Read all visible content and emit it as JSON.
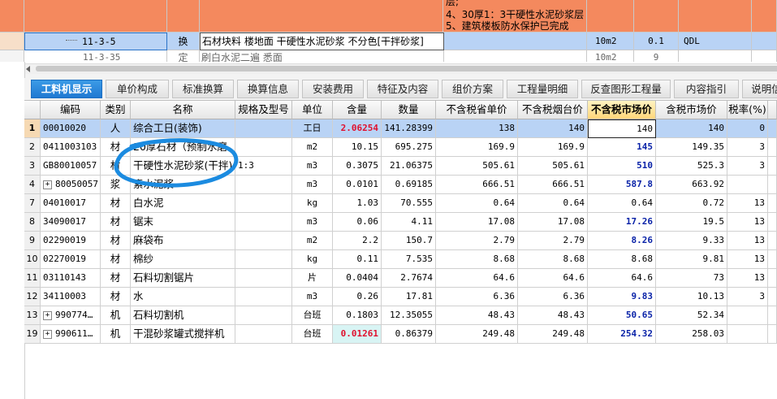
{
  "upper": {
    "top_row_text": [
      "层;",
      "4、30厚1：3干硬性水泥砂浆层",
      "5、建筑楼板防水保护已完成"
    ],
    "selected_row": {
      "code": "11-3-5",
      "type": "换",
      "name": "石材块料 楼地面 干硬性水泥砂浆 不分色[干拌砂浆]",
      "unit": "10m2",
      "qty": "0.1",
      "expr": "QDL"
    },
    "partial_row": {
      "code": "11-3-35",
      "type": "定",
      "name": "刷白水泥二遍 悉面",
      "unit": "10m2",
      "qty": "9"
    }
  },
  "tabs": [
    {
      "label": "工料机显示",
      "active": true
    },
    {
      "label": "单价构成",
      "active": false
    },
    {
      "label": "标准换算",
      "active": false
    },
    {
      "label": "换算信息",
      "active": false
    },
    {
      "label": "安装费用",
      "active": false
    },
    {
      "label": "特征及内容",
      "active": false
    },
    {
      "label": "组价方案",
      "active": false
    },
    {
      "label": "工程量明细",
      "active": false
    },
    {
      "label": "反查图形工程量",
      "active": false
    },
    {
      "label": "内容指引",
      "active": false
    },
    {
      "label": "说明信",
      "active": false
    }
  ],
  "columns": [
    "编码",
    "类别",
    "名称",
    "规格及型号",
    "单位",
    "含量",
    "数量",
    "不含税省单价",
    "不含税烟台价",
    "不含税市场价",
    "含税市场价",
    "税率(%)"
  ],
  "rows": [
    {
      "no": "1",
      "expand": false,
      "code": "00010020",
      "cat": "人",
      "name": "综合工日(装饰)",
      "spec": "",
      "unit": "工日",
      "content": "2.06254",
      "qty": "141.28399",
      "prov": "138",
      "yt": "140",
      "market": "140",
      "tax_market": "140",
      "rate": "0"
    },
    {
      "no": "2",
      "expand": false,
      "code": "0411003103",
      "cat": "材",
      "name": "20厚石材（预制水磨",
      "spec": "",
      "unit": "m2",
      "content": "10.15",
      "qty": "695.275",
      "prov": "169.9",
      "yt": "169.9",
      "market": "145",
      "tax_market": "149.35",
      "rate": "3"
    },
    {
      "no": "3",
      "expand": false,
      "code": "GB80010057",
      "cat": "材",
      "name": "干硬性水泥砂浆(干拌)",
      "spec": "1:3",
      "unit": "m3",
      "content": "0.3075",
      "qty": "21.06375",
      "prov": "505.61",
      "yt": "505.61",
      "market": "510",
      "tax_market": "525.3",
      "rate": "3"
    },
    {
      "no": "4",
      "expand": true,
      "code": "80050057",
      "cat": "浆",
      "name": "素水泥浆",
      "spec": "",
      "unit": "m3",
      "content": "0.0101",
      "qty": "0.69185",
      "prov": "666.51",
      "yt": "666.51",
      "market": "587.8",
      "tax_market": "663.92",
      "rate": ""
    },
    {
      "no": "7",
      "expand": false,
      "code": "04010017",
      "cat": "材",
      "name": "白水泥",
      "spec": "",
      "unit": "kg",
      "content": "1.03",
      "qty": "70.555",
      "prov": "0.64",
      "yt": "0.64",
      "market": "0.64",
      "tax_market": "0.72",
      "rate": "13"
    },
    {
      "no": "8",
      "expand": false,
      "code": "34090017",
      "cat": "材",
      "name": "锯末",
      "spec": "",
      "unit": "m3",
      "content": "0.06",
      "qty": "4.11",
      "prov": "17.08",
      "yt": "17.08",
      "market": "17.26",
      "tax_market": "19.5",
      "rate": "13"
    },
    {
      "no": "9",
      "expand": false,
      "code": "02290019",
      "cat": "材",
      "name": "麻袋布",
      "spec": "",
      "unit": "m2",
      "content": "2.2",
      "qty": "150.7",
      "prov": "2.79",
      "yt": "2.79",
      "market": "8.26",
      "tax_market": "9.33",
      "rate": "13"
    },
    {
      "no": "10",
      "expand": false,
      "code": "02270019",
      "cat": "材",
      "name": "棉纱",
      "spec": "",
      "unit": "kg",
      "content": "0.11",
      "qty": "7.535",
      "prov": "8.68",
      "yt": "8.68",
      "market": "8.68",
      "tax_market": "9.81",
      "rate": "13"
    },
    {
      "no": "11",
      "expand": false,
      "code": "03110143",
      "cat": "材",
      "name": "石料切割锯片",
      "spec": "",
      "unit": "片",
      "content": "0.0404",
      "qty": "2.7674",
      "prov": "64.6",
      "yt": "64.6",
      "market": "64.6",
      "tax_market": "73",
      "rate": "13"
    },
    {
      "no": "12",
      "expand": false,
      "code": "34110003",
      "cat": "材",
      "name": "水",
      "spec": "",
      "unit": "m3",
      "content": "0.26",
      "qty": "17.81",
      "prov": "6.36",
      "yt": "6.36",
      "market": "9.83",
      "tax_market": "10.13",
      "rate": "3"
    },
    {
      "no": "13",
      "expand": true,
      "code": "990774…",
      "cat": "机",
      "name": "石料切割机",
      "spec": "",
      "unit": "台班",
      "content": "0.1803",
      "qty": "12.35055",
      "prov": "48.43",
      "yt": "48.43",
      "market": "50.65",
      "tax_market": "52.34",
      "rate": ""
    },
    {
      "no": "19",
      "expand": true,
      "code": "990611…",
      "cat": "机",
      "name": "干混砂浆罐式搅拌机",
      "spec": "",
      "unit": "台班",
      "content": "0.01261",
      "qty": "0.86379",
      "prov": "249.48",
      "yt": "249.48",
      "market": "254.32",
      "tax_market": "258.03",
      "rate": ""
    }
  ],
  "colors": {
    "orange": "#f4895e",
    "selected_blue": "#b9d3f5",
    "tab_blue": "#2b86dc",
    "market_blue": "#0a23a8",
    "content_red": "#e0102e",
    "annotation_blue": "#1b8be0"
  }
}
